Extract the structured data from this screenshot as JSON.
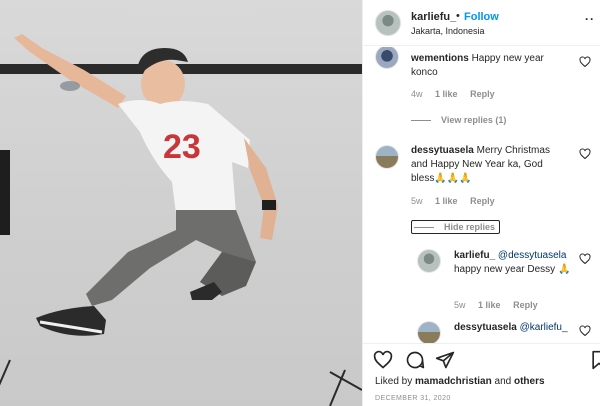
{
  "header": {
    "username": "karliefu_",
    "separator": "•",
    "follow_label": "Follow",
    "location": "Jakarta, Indonesia",
    "more_icon": "more-dots-icon"
  },
  "photo": {
    "shirt_number": "23"
  },
  "comments": [
    {
      "username": "wementions",
      "text": "Happy new year konco",
      "age": "4w",
      "likes": "1 like",
      "reply_label": "Reply",
      "view_replies": "View replies (1)"
    },
    {
      "username": "dessytuasela",
      "text": "Merry Christmas and Happy New Year ka, God bless🙏🙏🙏",
      "age": "5w",
      "likes": "1 like",
      "reply_label": "Reply",
      "hide_replies": "Hide replies"
    }
  ],
  "replies": [
    {
      "username": "karliefu_",
      "mention": "@dessytuasela",
      "text": "happy new year Dessy 🙏",
      "age": "5w",
      "likes": "1 like",
      "reply_label": "Reply"
    },
    {
      "username": "dessytuasela",
      "mention": "@karliefu_"
    }
  ],
  "actions": {
    "liked_by_prefix": "Liked by ",
    "liked_by_user": "mamadchristian",
    "liked_by_suffix": " and ",
    "liked_by_others": "others",
    "date": "DECEMBER 31, 2020"
  },
  "colors": {
    "link": "#0095f6",
    "mention": "#00376b",
    "muted": "#8e8e8e",
    "text": "#262626"
  }
}
